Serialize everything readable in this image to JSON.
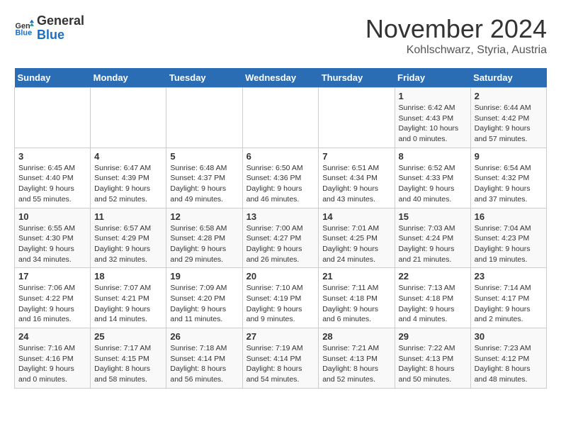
{
  "logo": {
    "text_general": "General",
    "text_blue": "Blue"
  },
  "header": {
    "month": "November 2024",
    "location": "Kohlschwarz, Styria, Austria"
  },
  "days_of_week": [
    "Sunday",
    "Monday",
    "Tuesday",
    "Wednesday",
    "Thursday",
    "Friday",
    "Saturday"
  ],
  "weeks": [
    [
      {
        "day": "",
        "info": ""
      },
      {
        "day": "",
        "info": ""
      },
      {
        "day": "",
        "info": ""
      },
      {
        "day": "",
        "info": ""
      },
      {
        "day": "",
        "info": ""
      },
      {
        "day": "1",
        "info": "Sunrise: 6:42 AM\nSunset: 4:43 PM\nDaylight: 10 hours and 0 minutes."
      },
      {
        "day": "2",
        "info": "Sunrise: 6:44 AM\nSunset: 4:42 PM\nDaylight: 9 hours and 57 minutes."
      }
    ],
    [
      {
        "day": "3",
        "info": "Sunrise: 6:45 AM\nSunset: 4:40 PM\nDaylight: 9 hours and 55 minutes."
      },
      {
        "day": "4",
        "info": "Sunrise: 6:47 AM\nSunset: 4:39 PM\nDaylight: 9 hours and 52 minutes."
      },
      {
        "day": "5",
        "info": "Sunrise: 6:48 AM\nSunset: 4:37 PM\nDaylight: 9 hours and 49 minutes."
      },
      {
        "day": "6",
        "info": "Sunrise: 6:50 AM\nSunset: 4:36 PM\nDaylight: 9 hours and 46 minutes."
      },
      {
        "day": "7",
        "info": "Sunrise: 6:51 AM\nSunset: 4:34 PM\nDaylight: 9 hours and 43 minutes."
      },
      {
        "day": "8",
        "info": "Sunrise: 6:52 AM\nSunset: 4:33 PM\nDaylight: 9 hours and 40 minutes."
      },
      {
        "day": "9",
        "info": "Sunrise: 6:54 AM\nSunset: 4:32 PM\nDaylight: 9 hours and 37 minutes."
      }
    ],
    [
      {
        "day": "10",
        "info": "Sunrise: 6:55 AM\nSunset: 4:30 PM\nDaylight: 9 hours and 34 minutes."
      },
      {
        "day": "11",
        "info": "Sunrise: 6:57 AM\nSunset: 4:29 PM\nDaylight: 9 hours and 32 minutes."
      },
      {
        "day": "12",
        "info": "Sunrise: 6:58 AM\nSunset: 4:28 PM\nDaylight: 9 hours and 29 minutes."
      },
      {
        "day": "13",
        "info": "Sunrise: 7:00 AM\nSunset: 4:27 PM\nDaylight: 9 hours and 26 minutes."
      },
      {
        "day": "14",
        "info": "Sunrise: 7:01 AM\nSunset: 4:25 PM\nDaylight: 9 hours and 24 minutes."
      },
      {
        "day": "15",
        "info": "Sunrise: 7:03 AM\nSunset: 4:24 PM\nDaylight: 9 hours and 21 minutes."
      },
      {
        "day": "16",
        "info": "Sunrise: 7:04 AM\nSunset: 4:23 PM\nDaylight: 9 hours and 19 minutes."
      }
    ],
    [
      {
        "day": "17",
        "info": "Sunrise: 7:06 AM\nSunset: 4:22 PM\nDaylight: 9 hours and 16 minutes."
      },
      {
        "day": "18",
        "info": "Sunrise: 7:07 AM\nSunset: 4:21 PM\nDaylight: 9 hours and 14 minutes."
      },
      {
        "day": "19",
        "info": "Sunrise: 7:09 AM\nSunset: 4:20 PM\nDaylight: 9 hours and 11 minutes."
      },
      {
        "day": "20",
        "info": "Sunrise: 7:10 AM\nSunset: 4:19 PM\nDaylight: 9 hours and 9 minutes."
      },
      {
        "day": "21",
        "info": "Sunrise: 7:11 AM\nSunset: 4:18 PM\nDaylight: 9 hours and 6 minutes."
      },
      {
        "day": "22",
        "info": "Sunrise: 7:13 AM\nSunset: 4:18 PM\nDaylight: 9 hours and 4 minutes."
      },
      {
        "day": "23",
        "info": "Sunrise: 7:14 AM\nSunset: 4:17 PM\nDaylight: 9 hours and 2 minutes."
      }
    ],
    [
      {
        "day": "24",
        "info": "Sunrise: 7:16 AM\nSunset: 4:16 PM\nDaylight: 9 hours and 0 minutes."
      },
      {
        "day": "25",
        "info": "Sunrise: 7:17 AM\nSunset: 4:15 PM\nDaylight: 8 hours and 58 minutes."
      },
      {
        "day": "26",
        "info": "Sunrise: 7:18 AM\nSunset: 4:14 PM\nDaylight: 8 hours and 56 minutes."
      },
      {
        "day": "27",
        "info": "Sunrise: 7:19 AM\nSunset: 4:14 PM\nDaylight: 8 hours and 54 minutes."
      },
      {
        "day": "28",
        "info": "Sunrise: 7:21 AM\nSunset: 4:13 PM\nDaylight: 8 hours and 52 minutes."
      },
      {
        "day": "29",
        "info": "Sunrise: 7:22 AM\nSunset: 4:13 PM\nDaylight: 8 hours and 50 minutes."
      },
      {
        "day": "30",
        "info": "Sunrise: 7:23 AM\nSunset: 4:12 PM\nDaylight: 8 hours and 48 minutes."
      }
    ]
  ]
}
